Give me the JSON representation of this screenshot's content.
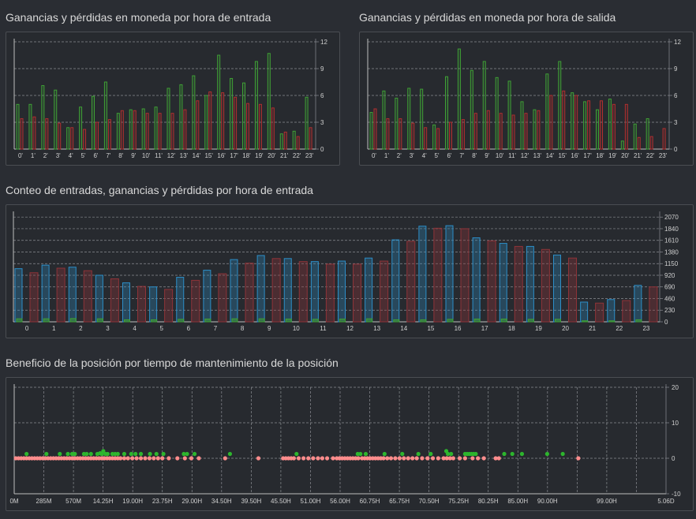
{
  "colors": {
    "profit": "#3fa035",
    "loss": "#b02f2f",
    "count": "#2c8ec8",
    "losing_count": "#8e3338",
    "zero_profit": "#ff8c8c",
    "pos_profit": "#2db52d",
    "grid": "#8a8d92",
    "axis_text": "#d0d0d0"
  },
  "titles": {
    "entry_hour": "Ganancias y pérdidas en moneda por hora de entrada",
    "exit_hour": "Ganancias y pérdidas en moneda por hora de salida",
    "count_hour": "Conteo de entradas, ganancias y pérdidas por hora de entrada",
    "holding": "Beneficio de la posición por tiempo de mantenimiento de la posición"
  },
  "chart_data": [
    {
      "id": "entry_hour",
      "type": "bar",
      "title": "Ganancias y pérdidas en moneda por hora de entrada",
      "categories": [
        "0",
        "1",
        "2",
        "3",
        "4",
        "5",
        "6",
        "7",
        "8",
        "9",
        "10",
        "11",
        "12",
        "13",
        "14",
        "15",
        "16",
        "17",
        "18",
        "19",
        "20",
        "21",
        "22",
        "23"
      ],
      "series": [
        {
          "values": [
            5.0,
            5.0,
            7.1,
            6.6,
            2.4,
            4.7,
            5.9,
            7.5,
            4.0,
            4.4,
            4.5,
            4.7,
            6.8,
            7.2,
            8.2,
            6.0,
            10.5,
            7.9,
            7.4,
            9.8,
            10.7,
            1.7,
            2.0,
            5.8
          ]
        },
        {
          "values": [
            3.4,
            3.6,
            3.4,
            2.9,
            2.4,
            2.2,
            3.0,
            3.3,
            4.3,
            4.3,
            4.0,
            4.0,
            4.0,
            4.4,
            5.4,
            6.4,
            6.3,
            5.8,
            5.1,
            5.0,
            4.6,
            1.9,
            1.4,
            2.4
          ]
        }
      ],
      "yticks": [
        0,
        3,
        6,
        9,
        12
      ],
      "ylim": [
        0,
        12
      ]
    },
    {
      "id": "exit_hour",
      "type": "bar",
      "title": "Ganancias y pérdidas en moneda por hora de salida",
      "categories": [
        "0",
        "1",
        "2",
        "3",
        "4",
        "5",
        "6",
        "7",
        "8",
        "9",
        "10",
        "11",
        "12",
        "13",
        "14",
        "15",
        "16",
        "17",
        "18",
        "19",
        "20",
        "21",
        "22",
        "23"
      ],
      "series": [
        {
          "values": [
            4.1,
            6.5,
            5.7,
            6.8,
            6.7,
            2.7,
            8.1,
            11.2,
            8.8,
            9.8,
            8.0,
            7.6,
            5.3,
            4.4,
            8.4,
            9.8,
            6.3,
            5.3,
            4.4,
            5.6,
            0.9,
            2.8,
            3.4,
            0
          ]
        },
        {
          "values": [
            4.5,
            3.4,
            3.4,
            2.9,
            2.4,
            2.3,
            3.0,
            3.3,
            4.0,
            4.3,
            4.0,
            3.8,
            4.0,
            4.3,
            6.0,
            6.5,
            6.0,
            5.4,
            5.4,
            5.0,
            5.0,
            1.3,
            1.4,
            2.3
          ]
        }
      ],
      "yticks": [
        0,
        3,
        6,
        9,
        12
      ],
      "ylim": [
        0,
        12
      ]
    },
    {
      "id": "count_hour",
      "type": "bar",
      "title": "Conteo de entradas, ganancias y pérdidas por hora de entrada",
      "categories": [
        "0",
        "1",
        "2",
        "3",
        "4",
        "5",
        "6",
        "7",
        "8",
        "9",
        "10",
        "11",
        "12",
        "13",
        "14",
        "15",
        "16",
        "17",
        "18",
        "19",
        "20",
        "21",
        "22",
        "23"
      ],
      "series": [
        {
          "values": [
            1050,
            1120,
            1080,
            920,
            770,
            690,
            880,
            1020,
            1230,
            1310,
            1250,
            1190,
            1200,
            1260,
            1620,
            1890,
            1900,
            1660,
            1550,
            1490,
            1320,
            390,
            440,
            720
          ]
        },
        {
          "values": [
            970,
            1060,
            1010,
            850,
            700,
            640,
            820,
            950,
            1160,
            1250,
            1190,
            1140,
            1140,
            1200,
            1590,
            1850,
            1840,
            1600,
            1490,
            1430,
            1260,
            370,
            420,
            690
          ]
        },
        {
          "values": [
            60,
            60,
            65,
            60,
            40,
            40,
            50,
            55,
            60,
            60,
            55,
            50,
            55,
            60,
            40,
            40,
            50,
            55,
            55,
            50,
            50,
            20,
            20,
            40
          ]
        }
      ],
      "yticks": [
        0,
        230,
        460,
        690,
        920,
        1150,
        1380,
        1610,
        1840,
        2070
      ],
      "ylim": [
        0,
        2120
      ]
    },
    {
      "id": "holding",
      "type": "scatter",
      "title": "Beneficio de la posición por tiempo de mantenimiento de la posición",
      "xticklabels": [
        "0M",
        "285M",
        "570M",
        "14.25H",
        "19.00H",
        "23.75H",
        "29.00H",
        "34.50H",
        "39.50H",
        "45.50H",
        "51.00H",
        "56.00H",
        "60.75H",
        "65.75H",
        "70.50H",
        "75.25H",
        "80.25H",
        "85.00H",
        "90.00H",
        "",
        "99.00H",
        "",
        "5.06D"
      ],
      "yticks": [
        -10,
        0,
        10,
        20
      ],
      "ylim": [
        -10,
        20
      ],
      "zero_hours": [
        0.3,
        0.8,
        1.3,
        1.8,
        2.3,
        2.8,
        3.3,
        3.8,
        4.3,
        4.8,
        5.3,
        5.8,
        6.3,
        6.8,
        7.3,
        7.8,
        8.3,
        8.8,
        9.3,
        9.8,
        10.3,
        10.8,
        11.3,
        11.8,
        12.3,
        12.8,
        13.3,
        13.8,
        14.3,
        14.8,
        15.3,
        15.8,
        16.3,
        16.8,
        17.3,
        17.8,
        18.3,
        18.8,
        19.3,
        19.8,
        20.5,
        21.2,
        22.0,
        22.8,
        23.6,
        24.4,
        25.2,
        26.0,
        26.8,
        27.6,
        28.8,
        30.4,
        31.8,
        33.0,
        34.4,
        39.3,
        45.5,
        50.1,
        50.6,
        51.1,
        51.6,
        52.1,
        53.0,
        53.9,
        54.8,
        55.7,
        56.6,
        57.4,
        58.3,
        59.4,
        60.1,
        60.6,
        61.1,
        61.6,
        62.1,
        62.6,
        63.1,
        63.6,
        64.1,
        64.8,
        65.3,
        65.8,
        66.3,
        66.8,
        67.3,
        67.8,
        68.3,
        68.8,
        69.5,
        70.2,
        71.0,
        71.8,
        72.6,
        73.4,
        74.2,
        75.0,
        76.0,
        77.0,
        78.0,
        79.0,
        80.0,
        80.6,
        81.2,
        81.8,
        83.0,
        84.0,
        85.4,
        86.4,
        87.5,
        89.7,
        90.3,
        105.1
      ],
      "profits": [
        [
          2.3,
          1.0
        ],
        [
          6.0,
          1.0
        ],
        [
          8.5,
          1.0
        ],
        [
          10.0,
          1.0
        ],
        [
          10.8,
          1.0
        ],
        [
          11.3,
          1.0
        ],
        [
          13.0,
          1.0
        ],
        [
          13.5,
          1.0
        ],
        [
          14.3,
          1.0
        ],
        [
          15.5,
          1.0
        ],
        [
          16.0,
          1.2
        ],
        [
          16.3,
          1.0
        ],
        [
          16.6,
          1.8
        ],
        [
          17.0,
          1.0
        ],
        [
          17.4,
          1.0
        ],
        [
          18.3,
          1.0
        ],
        [
          18.8,
          1.0
        ],
        [
          19.3,
          1.0
        ],
        [
          20.5,
          1.0
        ],
        [
          21.8,
          1.0
        ],
        [
          22.6,
          1.0
        ],
        [
          23.6,
          1.0
        ],
        [
          25.3,
          1.0
        ],
        [
          26.5,
          1.0
        ],
        [
          27.8,
          1.0
        ],
        [
          31.6,
          1.0
        ],
        [
          32.2,
          1.0
        ],
        [
          33.6,
          1.0
        ],
        [
          40.2,
          1.0
        ],
        [
          52.6,
          1.0
        ],
        [
          64.0,
          1.0
        ],
        [
          64.5,
          1.0
        ],
        [
          65.5,
          1.0
        ],
        [
          69.0,
          1.0
        ],
        [
          72.3,
          1.0
        ],
        [
          75.3,
          1.0
        ],
        [
          77.6,
          1.0
        ],
        [
          80.5,
          1.8
        ],
        [
          80.8,
          1.0
        ],
        [
          81.4,
          1.0
        ],
        [
          84.0,
          1.0
        ],
        [
          84.4,
          1.0
        ],
        [
          84.8,
          1.0
        ],
        [
          85.2,
          1.0
        ],
        [
          85.6,
          1.0
        ],
        [
          86.0,
          1.0
        ],
        [
          91.3,
          1.0
        ],
        [
          92.8,
          1.0
        ],
        [
          94.6,
          1.0
        ],
        [
          99.3,
          1.0
        ],
        [
          102.2,
          1.0
        ]
      ]
    }
  ]
}
